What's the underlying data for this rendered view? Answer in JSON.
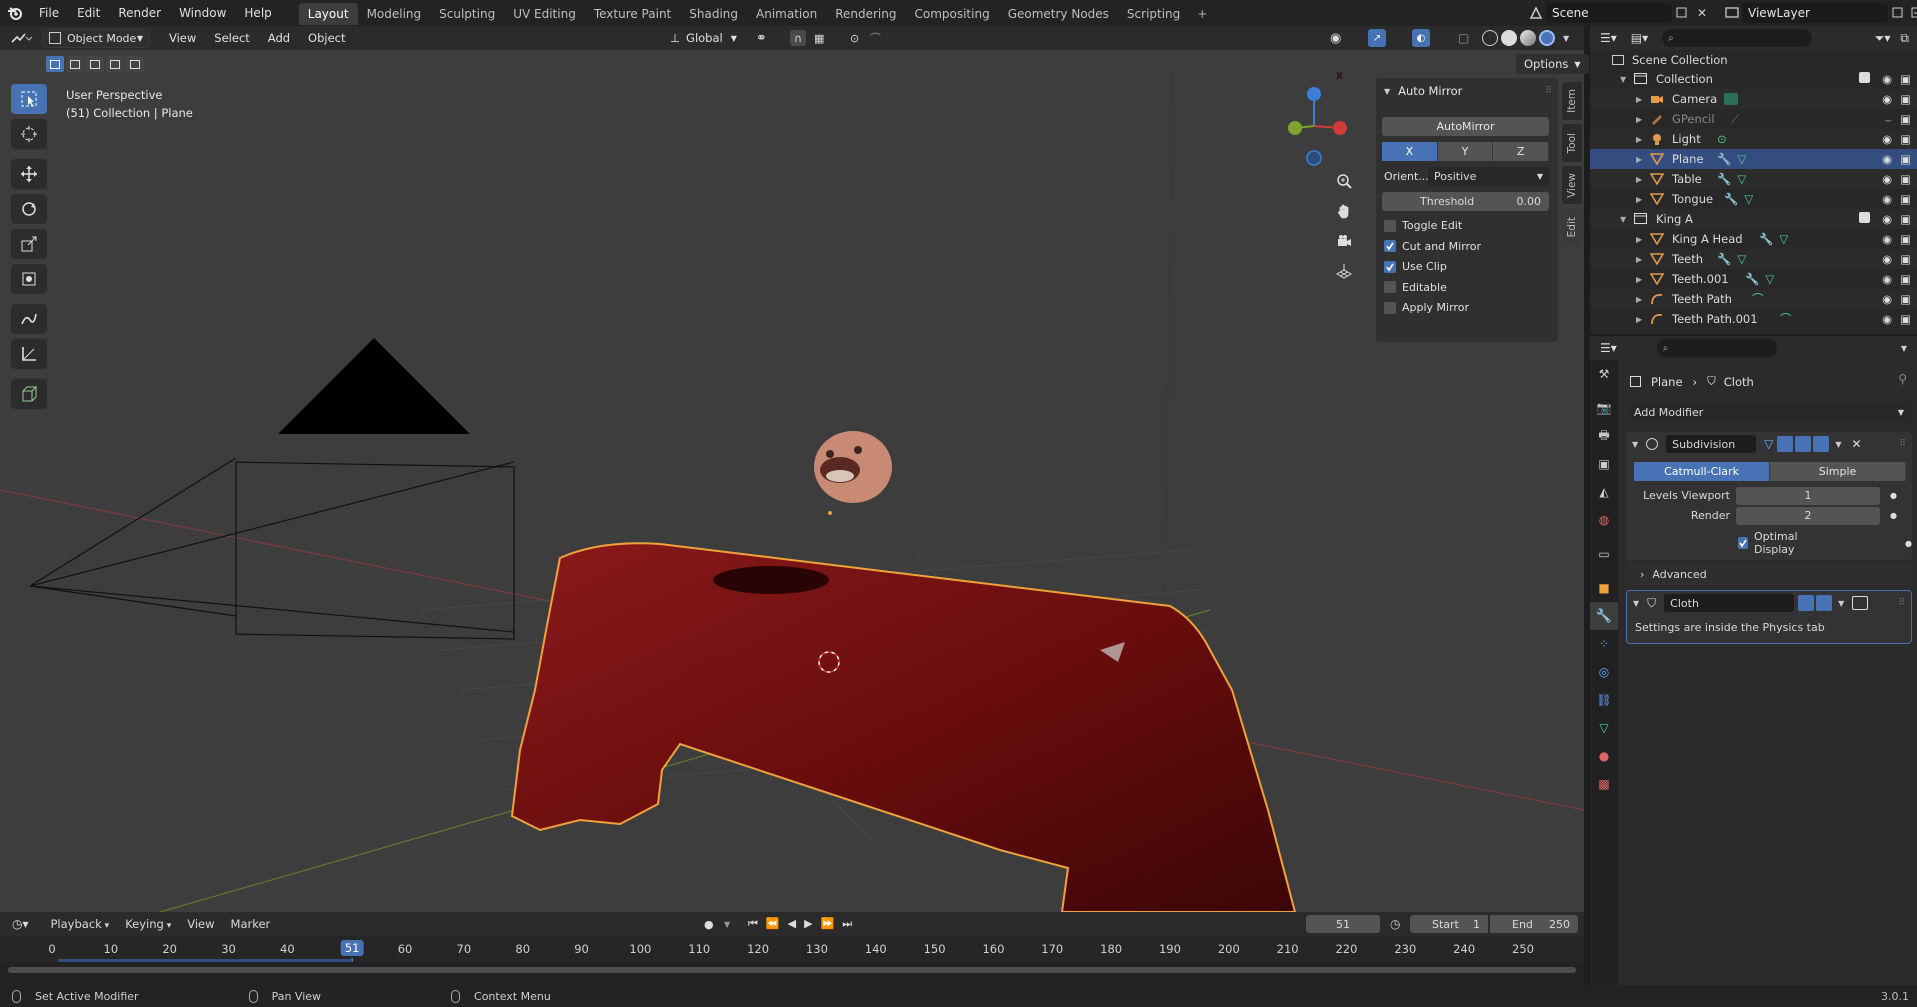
{
  "topbar": {
    "menus": [
      "File",
      "Edit",
      "Render",
      "Window",
      "Help"
    ],
    "tabs": [
      "Layout",
      "Modeling",
      "Sculpting",
      "UV Editing",
      "Texture Paint",
      "Shading",
      "Animation",
      "Rendering",
      "Compositing",
      "Geometry Nodes",
      "Scripting"
    ],
    "active_tab": "Layout",
    "add_tab": "+",
    "scene": "Scene",
    "view_layer": "ViewLayer"
  },
  "viewport_header": {
    "mode": "Object Mode",
    "menus": [
      "View",
      "Select",
      "Add",
      "Object"
    ],
    "orientation": "Global",
    "options": "Options"
  },
  "viewport": {
    "perspective": "User Perspective",
    "context": "(51) Collection | Plane"
  },
  "gizmo": {
    "z": "Z",
    "x": "X",
    "y": "Y"
  },
  "npanel": {
    "title": "Auto Mirror",
    "automirror_button": "AutoMirror",
    "axes": [
      "X",
      "Y",
      "Z"
    ],
    "active_axis": "X",
    "orient_label": "Orient...",
    "orient_value": "Positive",
    "threshold_label": "Threshold",
    "threshold_value": "0.00",
    "options": [
      {
        "label": "Toggle Edit",
        "checked": false
      },
      {
        "label": "Cut and Mirror",
        "checked": true
      },
      {
        "label": "Use Clip",
        "checked": true
      },
      {
        "label": "Editable",
        "checked": false
      },
      {
        "label": "Apply Mirror",
        "checked": false
      }
    ],
    "side_tabs": [
      "Item",
      "Tool",
      "View",
      "Edit"
    ]
  },
  "outliner": {
    "root": "Scene Collection",
    "rows": [
      {
        "name": "Collection",
        "type": "collection",
        "level": 0
      },
      {
        "name": "Camera",
        "type": "camera",
        "level": 1
      },
      {
        "name": "GPencil",
        "type": "gpencil",
        "level": 1
      },
      {
        "name": "Light",
        "type": "light",
        "level": 1
      },
      {
        "name": "Plane",
        "type": "mesh",
        "level": 1,
        "selected": true
      },
      {
        "name": "Table",
        "type": "mesh",
        "level": 1
      },
      {
        "name": "Tongue",
        "type": "mesh",
        "level": 1
      },
      {
        "name": "King A",
        "type": "collection",
        "level": 0
      },
      {
        "name": "King A Head",
        "type": "mesh",
        "level": 1
      },
      {
        "name": "Teeth",
        "type": "mesh",
        "level": 1
      },
      {
        "name": "Teeth.001",
        "type": "mesh",
        "level": 1
      },
      {
        "name": "Teeth Path",
        "type": "curve",
        "level": 1
      },
      {
        "name": "Teeth Path.001",
        "type": "curve",
        "level": 1
      }
    ]
  },
  "properties": {
    "breadcrumb_object": "Plane",
    "breadcrumb_modifier": "Cloth",
    "add_modifier": "Add Modifier",
    "subdivision": {
      "name": "Subdivision",
      "types": [
        "Catmull-Clark",
        "Simple"
      ],
      "active_type": "Catmull-Clark",
      "levels_viewport_label": "Levels Viewport",
      "levels_viewport": "1",
      "render_label": "Render",
      "render": "2",
      "optimal_display": "Optimal Display",
      "advanced": "Advanced"
    },
    "cloth": {
      "name": "Cloth",
      "note": "Settings are inside the Physics tab"
    }
  },
  "timeline": {
    "menus": [
      "Playback",
      "Keying",
      "View",
      "Marker"
    ],
    "current_frame": "51",
    "start_label": "Start",
    "start": "1",
    "end_label": "End",
    "end": "250",
    "ticks": [
      "0",
      "10",
      "20",
      "30",
      "40",
      "51",
      "60",
      "70",
      "80",
      "90",
      "100",
      "110",
      "120",
      "130",
      "140",
      "150",
      "160",
      "170",
      "180",
      "190",
      "200",
      "210",
      "220",
      "230",
      "240",
      "250"
    ]
  },
  "statusbar": {
    "hint1": "Set Active Modifier",
    "hint2": "Pan View",
    "hint3": "Context Menu",
    "version": "3.0.1"
  },
  "colors": {
    "accent": "#4772b3",
    "selection_outline": "#f0a23a",
    "cloth": "#8a1414",
    "viewport_bg": "#3d3d3d"
  }
}
